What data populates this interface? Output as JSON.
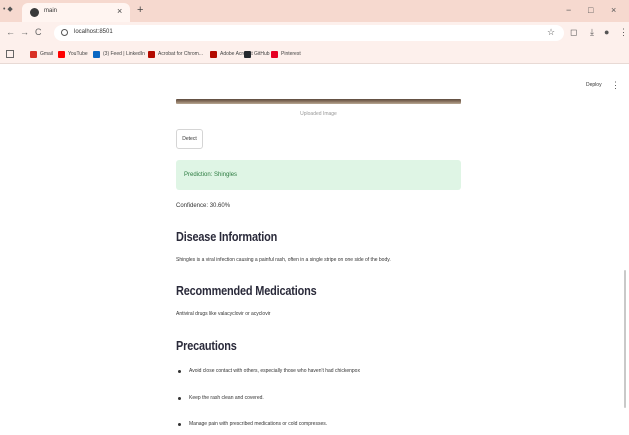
{
  "browser": {
    "window_menu": "• ◆",
    "tab": {
      "title": "main"
    },
    "new_tab": "+",
    "controls": {
      "minimize": "−",
      "maximize": "□",
      "close": "×"
    },
    "nav": {
      "back": "←",
      "forward": "→",
      "reload": "C"
    },
    "url": "localhost:8501",
    "bookmarks": [
      {
        "label": "Gmail",
        "color": "#d93025"
      },
      {
        "label": "YouTube",
        "color": "#ff0000"
      },
      {
        "label": "(3) Feed | LinkedIn",
        "color": "#0a66c2"
      },
      {
        "label": "Acrobat for Chrom...",
        "color": "#b30b00"
      },
      {
        "label": "Adobe Acrobat",
        "color": "#b30b00"
      },
      {
        "label": "GitHub",
        "color": "#24292e"
      },
      {
        "label": "Pinterest",
        "color": "#e60023"
      }
    ]
  },
  "app": {
    "deploy_label": "Deploy",
    "menu_label": "⋮",
    "image_caption": "Uploaded Image",
    "detect_label": "Detect",
    "prediction": "Prediction: Shingles",
    "confidence": "Confidence: 30.60%",
    "disease_heading": "Disease Information",
    "disease_text": "Shingles is a viral infection causing a painful rash, often in a single stripe on one side of the body.",
    "medications_heading": "Recommended Medications",
    "medications_text": "Antiviral drugs like valacyclovir or acyclovir",
    "precautions_heading": "Precautions",
    "precautions": [
      "Avoid close contact with others, especially those who haven't had chickenpox",
      "Keep the rash clean and covered.",
      "Manage pain with prescribed medications or cold compresses."
    ]
  },
  "colors": {
    "titlebar": "#f6d9cf",
    "success_bg": "#dff5e5",
    "success_text": "#2a7a3e"
  }
}
